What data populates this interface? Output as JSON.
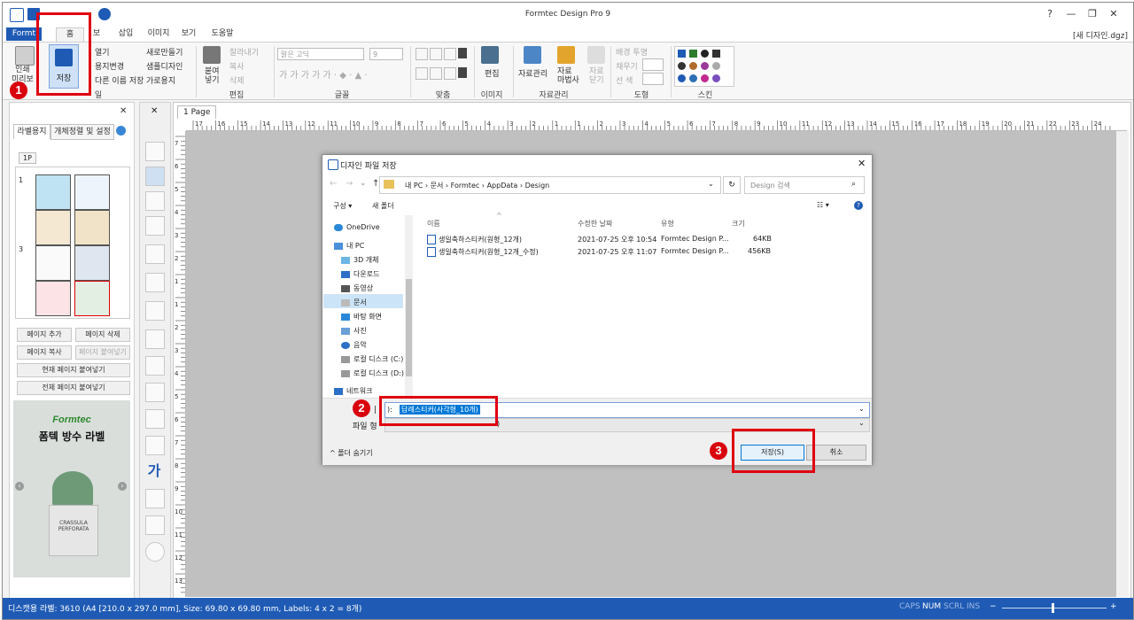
{
  "app": {
    "title": "Formtec Design Pro 9",
    "doc_name": "[새 디자인.dgz]"
  },
  "tabs": [
    {
      "label": "Formt"
    },
    {
      "label": "홈"
    },
    {
      "label": "보"
    },
    {
      "label": "삽입"
    },
    {
      "label": "이미지"
    },
    {
      "label": "보기"
    },
    {
      "label": "도움말"
    }
  ],
  "ribbon": {
    "print_preview": "인쇄\n미리보",
    "save": "저장",
    "file_items": [
      "열기",
      "용지변경",
      "다른 이름 저장"
    ],
    "new_items": [
      "새로만들기",
      "샘플디자인",
      "가로용지"
    ],
    "file_group": "일",
    "paste": "붙여\n넣기",
    "edit_items": [
      "잘라내기",
      "복사",
      "삭제"
    ],
    "edit_group": "편집",
    "font_name": "맑은 고딕",
    "font_size": "9",
    "font_group": "글꼴",
    "align_group": "맞춤",
    "edit_image": "편집",
    "image_group": "이미지",
    "data_manage": "자료관리",
    "data_wizard": "자료\n마법사",
    "data_close": "자료\n닫기",
    "data_group": "자료관리",
    "shape_items": [
      "배경 투명",
      "채우기",
      "선    색"
    ],
    "shape_group": "도형",
    "skin_group": "스킨"
  },
  "left_panel": {
    "tabs": [
      "라벨용지",
      "개체정렬 및 설정"
    ],
    "page_tab": "1P",
    "row_labels": [
      "1",
      "3"
    ],
    "buttons": [
      "페이지 추가",
      "페이지 삭제",
      "페이지 복사",
      "페이지 붙여넣기",
      "현재 페이지 붙여넣기",
      "전체 페이지 붙여넣기"
    ],
    "ad_brand": "Formtec",
    "ad_title": "폼텍 방수 라벨",
    "ad_pot_text": "CRASSULA\nPERFORATA"
  },
  "canvas": {
    "page_tab": "1 Page",
    "ruler_labels": [
      "17",
      "16",
      "15",
      "14",
      "13",
      "12",
      "11",
      "10",
      "9",
      "8",
      "7",
      "6",
      "5",
      "4",
      "3",
      "2",
      "1",
      "1",
      "2",
      "3",
      "4",
      "5",
      "6",
      "7",
      "8",
      "9",
      "10",
      "11",
      "12",
      "13",
      "14",
      "15",
      "16",
      "17",
      "18",
      "19",
      "20",
      "21",
      "22",
      "23",
      "24"
    ],
    "vruler_labels": [
      "7",
      "6",
      "5",
      "4",
      "3",
      "2",
      "1",
      "1",
      "2",
      "3",
      "4",
      "5",
      "6",
      "7",
      "8",
      "9",
      "10",
      "11",
      "12",
      "13"
    ]
  },
  "dialog": {
    "title": "디자인 파일 저장",
    "breadcrumb": [
      "내 PC",
      "문서",
      "Formtec",
      "AppData",
      "Design"
    ],
    "search_placeholder": "Design 검색",
    "organize": "구성 ▾",
    "new_folder": "새 폴더",
    "nav": [
      {
        "label": "OneDrive",
        "icon": "cloud-icon"
      },
      {
        "label": "내 PC",
        "icon": "pc-icon"
      },
      {
        "label": "3D 개체",
        "icon": "3d-icon"
      },
      {
        "label": "다운로드",
        "icon": "download-icon"
      },
      {
        "label": "동영상",
        "icon": "video-icon"
      },
      {
        "label": "문서",
        "icon": "document-icon"
      },
      {
        "label": "바탕 화면",
        "icon": "desktop-icon"
      },
      {
        "label": "사진",
        "icon": "picture-icon"
      },
      {
        "label": "음악",
        "icon": "music-icon"
      },
      {
        "label": "로컬 디스크 (C:)",
        "icon": "drive-icon"
      },
      {
        "label": "로컬 디스크 (D:)",
        "icon": "drive-icon"
      },
      {
        "label": "네트워크",
        "icon": "network-icon"
      }
    ],
    "columns": [
      "이름",
      "수정한 날짜",
      "유형",
      "크기"
    ],
    "files": [
      {
        "name": "생일축하스티커(원형_12개)",
        "date": "2021-07-25 오후 10:54",
        "type": "Formtec Design P...",
        "size": "64KB"
      },
      {
        "name": "생일축하스티커(원형_12개_수정)",
        "date": "2021-07-25 오후 11:07",
        "type": "Formtec Design P...",
        "size": "456KB"
      }
    ],
    "filename_label": "|",
    "filename_prefix": "):",
    "filename_value": "답례스티커(사각형_10개)",
    "filetype_label": "파일 형",
    "filetype_value": ")",
    "hide_folders": "폴더 숨기기",
    "save_button": "저장(S)",
    "cancel_button": "취소"
  },
  "annotations": [
    "1",
    "2",
    "3"
  ],
  "status": {
    "left": "디스캣용 라벨: 3610 (A4 [210.0 x 297.0 mm], Size: 69.80 x 69.80 mm, Labels: 4 x 2 = 8개)",
    "caps": "CAPS",
    "num": "NUM",
    "scrl": "SCRL",
    "ins": "INS",
    "zoom_minus": "−",
    "zoom_plus": "+"
  },
  "colors": {
    "accent": "#1f5bb5",
    "highlight": "#e0000f"
  }
}
